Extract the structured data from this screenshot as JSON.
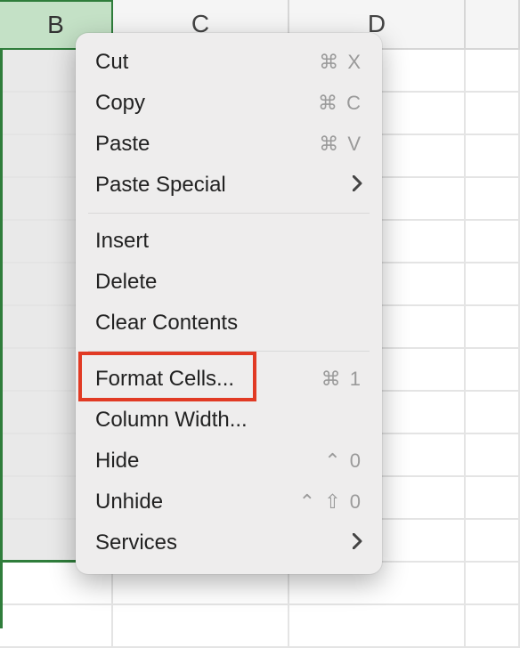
{
  "columns": {
    "b": "B",
    "c": "C",
    "d": "D"
  },
  "menu": {
    "cut": {
      "label": "Cut",
      "shortcut": "⌘ X"
    },
    "copy": {
      "label": "Copy",
      "shortcut": "⌘ C"
    },
    "paste": {
      "label": "Paste",
      "shortcut": "⌘ V"
    },
    "paste_special": {
      "label": "Paste Special"
    },
    "insert": {
      "label": "Insert"
    },
    "delete": {
      "label": "Delete"
    },
    "clear": {
      "label": "Clear Contents"
    },
    "format_cells": {
      "label": "Format Cells...",
      "shortcut": "⌘ 1"
    },
    "column_width": {
      "label": "Column Width..."
    },
    "hide": {
      "label": "Hide",
      "shortcut": "⌃ 0"
    },
    "unhide": {
      "label": "Unhide",
      "shortcut": "⌃ ⇧ 0"
    },
    "services": {
      "label": "Services"
    }
  }
}
